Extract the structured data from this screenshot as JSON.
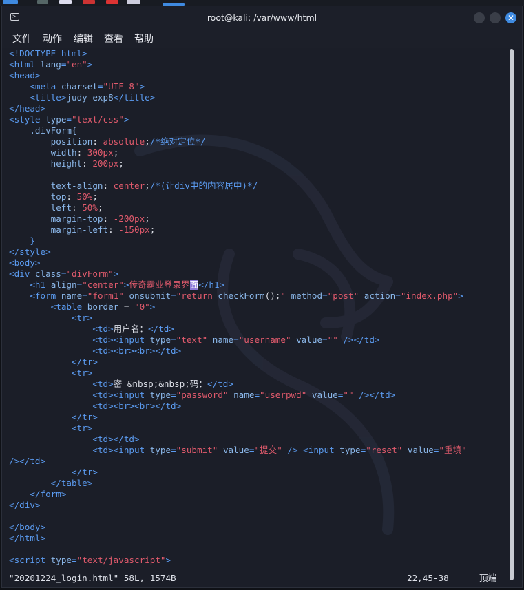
{
  "window": {
    "title": "root@kali: /var/www/html",
    "close_glyph": "✕"
  },
  "menu": [
    "文件",
    "动作",
    "编辑",
    "查看",
    "帮助"
  ],
  "code_lines": [
    [
      [
        "t",
        "<!DOCTYPE html>"
      ]
    ],
    [
      [
        "t",
        "<html "
      ],
      [
        "a",
        "lang"
      ],
      [
        "t",
        "="
      ],
      [
        "s",
        "\"en\""
      ],
      [
        "t",
        ">"
      ]
    ],
    [
      [
        "t",
        "<head>"
      ]
    ],
    [
      [
        "p",
        "    "
      ],
      [
        "t",
        "<meta "
      ],
      [
        "a",
        "charset"
      ],
      [
        "t",
        "="
      ],
      [
        "s",
        "\"UTF-8\""
      ],
      [
        "t",
        ">"
      ]
    ],
    [
      [
        "p",
        "    "
      ],
      [
        "t",
        "<title>"
      ],
      [
        "a",
        "judy-exp8"
      ],
      [
        "t",
        "</title>"
      ]
    ],
    [
      [
        "t",
        "</head>"
      ]
    ],
    [
      [
        "t",
        "<style "
      ],
      [
        "a",
        "type"
      ],
      [
        "t",
        "="
      ],
      [
        "s",
        "\"text/css\""
      ],
      [
        "t",
        ">"
      ]
    ],
    [
      [
        "p",
        "    "
      ],
      [
        "a",
        ".divForm{"
      ]
    ],
    [
      [
        "p",
        "        "
      ],
      [
        "a",
        "position"
      ],
      [
        "p",
        ": "
      ],
      [
        "s",
        "absolute"
      ],
      [
        "p",
        ";"
      ],
      [
        "c",
        "/*绝对定位*/"
      ]
    ],
    [
      [
        "p",
        "        "
      ],
      [
        "a",
        "width"
      ],
      [
        "p",
        ": "
      ],
      [
        "s",
        "300px"
      ],
      [
        "p",
        ";"
      ]
    ],
    [
      [
        "p",
        "        "
      ],
      [
        "a",
        "height"
      ],
      [
        "p",
        ": "
      ],
      [
        "s",
        "200px"
      ],
      [
        "p",
        ";"
      ]
    ],
    [
      [
        "p",
        ""
      ]
    ],
    [
      [
        "p",
        "        "
      ],
      [
        "a",
        "text-align"
      ],
      [
        "p",
        ": "
      ],
      [
        "s",
        "center"
      ],
      [
        "p",
        ";"
      ],
      [
        "c",
        "/*(让div中的内容居中)*/"
      ]
    ],
    [
      [
        "p",
        "        "
      ],
      [
        "a",
        "top"
      ],
      [
        "p",
        ": "
      ],
      [
        "s",
        "50%"
      ],
      [
        "p",
        ";"
      ]
    ],
    [
      [
        "p",
        "        "
      ],
      [
        "a",
        "left"
      ],
      [
        "p",
        ": "
      ],
      [
        "s",
        "50%"
      ],
      [
        "p",
        ";"
      ]
    ],
    [
      [
        "p",
        "        "
      ],
      [
        "a",
        "margin-top"
      ],
      [
        "p",
        ": "
      ],
      [
        "s",
        "-200px"
      ],
      [
        "p",
        ";"
      ]
    ],
    [
      [
        "p",
        "        "
      ],
      [
        "a",
        "margin-left"
      ],
      [
        "p",
        ": "
      ],
      [
        "s",
        "-150px"
      ],
      [
        "p",
        ";"
      ]
    ],
    [
      [
        "p",
        "    "
      ],
      [
        "t",
        "}"
      ]
    ],
    [
      [
        "t",
        "</style>"
      ]
    ],
    [
      [
        "t",
        "<body>"
      ]
    ],
    [
      [
        "t",
        "<div "
      ],
      [
        "a",
        "class"
      ],
      [
        "t",
        "="
      ],
      [
        "s",
        "\"divForm\""
      ],
      [
        "t",
        ">"
      ]
    ],
    [
      [
        "p",
        "    "
      ],
      [
        "t",
        "<h1 "
      ],
      [
        "a",
        "align"
      ],
      [
        "t",
        "="
      ],
      [
        "s",
        "\"center\""
      ],
      [
        "t",
        ">"
      ],
      [
        "s",
        "传奇霸业登录界"
      ],
      [
        "cursor",
        "面"
      ],
      [
        "t",
        "</h1>"
      ]
    ],
    [
      [
        "p",
        "    "
      ],
      [
        "t",
        "<form "
      ],
      [
        "a",
        "name"
      ],
      [
        "t",
        "="
      ],
      [
        "s",
        "\"form1\""
      ],
      [
        "p",
        " "
      ],
      [
        "a",
        "onsubmit"
      ],
      [
        "t",
        "="
      ],
      [
        "s",
        "\"return "
      ],
      [
        "a",
        "checkForm"
      ],
      [
        "p",
        "();"
      ],
      [
        "s",
        "\""
      ],
      [
        "p",
        " "
      ],
      [
        "a",
        "method"
      ],
      [
        "t",
        "="
      ],
      [
        "s",
        "\"post\""
      ],
      [
        "p",
        " "
      ],
      [
        "a",
        "action"
      ],
      [
        "t",
        "="
      ],
      [
        "s",
        "\"index.php\""
      ],
      [
        "t",
        ">"
      ]
    ],
    [
      [
        "p",
        "        "
      ],
      [
        "t",
        "<table "
      ],
      [
        "a",
        "border"
      ],
      [
        "p",
        " = "
      ],
      [
        "s",
        "\"0\""
      ],
      [
        "t",
        ">"
      ]
    ],
    [
      [
        "p",
        "            "
      ],
      [
        "t",
        "<tr>"
      ]
    ],
    [
      [
        "p",
        "                "
      ],
      [
        "t",
        "<td>"
      ],
      [
        "p",
        "用户名："
      ],
      [
        "t",
        "</td>"
      ]
    ],
    [
      [
        "p",
        "                "
      ],
      [
        "t",
        "<td><input "
      ],
      [
        "a",
        "type"
      ],
      [
        "t",
        "="
      ],
      [
        "s",
        "\"text\""
      ],
      [
        "p",
        " "
      ],
      [
        "a",
        "name"
      ],
      [
        "t",
        "="
      ],
      [
        "s",
        "\"username\""
      ],
      [
        "p",
        " "
      ],
      [
        "a",
        "value"
      ],
      [
        "t",
        "="
      ],
      [
        "s",
        "\"\""
      ],
      [
        "p",
        " "
      ],
      [
        "t",
        "/></td>"
      ]
    ],
    [
      [
        "p",
        "                "
      ],
      [
        "t",
        "<td><br><br></td>"
      ]
    ],
    [
      [
        "p",
        "            "
      ],
      [
        "t",
        "</tr>"
      ]
    ],
    [
      [
        "p",
        "            "
      ],
      [
        "t",
        "<tr>"
      ]
    ],
    [
      [
        "p",
        "                "
      ],
      [
        "t",
        "<td>"
      ],
      [
        "p",
        "密 &nbsp;&nbsp;码："
      ],
      [
        "t",
        "</td>"
      ]
    ],
    [
      [
        "p",
        "                "
      ],
      [
        "t",
        "<td><input "
      ],
      [
        "a",
        "type"
      ],
      [
        "t",
        "="
      ],
      [
        "s",
        "\"password\""
      ],
      [
        "p",
        " "
      ],
      [
        "a",
        "name"
      ],
      [
        "t",
        "="
      ],
      [
        "s",
        "\"userpwd\""
      ],
      [
        "p",
        " "
      ],
      [
        "a",
        "value"
      ],
      [
        "t",
        "="
      ],
      [
        "s",
        "\"\""
      ],
      [
        "p",
        " "
      ],
      [
        "t",
        "/></td>"
      ]
    ],
    [
      [
        "p",
        "                "
      ],
      [
        "t",
        "<td><br><br></td>"
      ]
    ],
    [
      [
        "p",
        "            "
      ],
      [
        "t",
        "</tr>"
      ]
    ],
    [
      [
        "p",
        "            "
      ],
      [
        "t",
        "<tr>"
      ]
    ],
    [
      [
        "p",
        "                "
      ],
      [
        "t",
        "<td></td>"
      ]
    ],
    [
      [
        "p",
        "                "
      ],
      [
        "t",
        "<td><input "
      ],
      [
        "a",
        "type"
      ],
      [
        "t",
        "="
      ],
      [
        "s",
        "\"submit\""
      ],
      [
        "p",
        " "
      ],
      [
        "a",
        "value"
      ],
      [
        "t",
        "="
      ],
      [
        "s",
        "\"提交\""
      ],
      [
        "p",
        " "
      ],
      [
        "t",
        "/>"
      ],
      [
        "p",
        " "
      ],
      [
        "t",
        "<input "
      ],
      [
        "a",
        "type"
      ],
      [
        "t",
        "="
      ],
      [
        "s",
        "\"reset\""
      ],
      [
        "p",
        " "
      ],
      [
        "a",
        "value"
      ],
      [
        "t",
        "="
      ],
      [
        "s",
        "\"重填\""
      ]
    ],
    [
      [
        "t",
        "/></td>"
      ]
    ],
    [
      [
        "p",
        "            "
      ],
      [
        "t",
        "</tr>"
      ]
    ],
    [
      [
        "p",
        "        "
      ],
      [
        "t",
        "</table>"
      ]
    ],
    [
      [
        "p",
        "    "
      ],
      [
        "t",
        "</form>"
      ]
    ],
    [
      [
        "t",
        "</div>"
      ]
    ],
    [
      [
        "p",
        ""
      ]
    ],
    [
      [
        "t",
        "</body>"
      ]
    ],
    [
      [
        "t",
        "</html>"
      ]
    ],
    [
      [
        "p",
        ""
      ]
    ],
    [
      [
        "t",
        "<script "
      ],
      [
        "a",
        "type"
      ],
      [
        "t",
        "="
      ],
      [
        "s",
        "\"text/javascript\""
      ],
      [
        "t",
        ">"
      ]
    ]
  ],
  "status": {
    "file_info": "\"20201224_login.html\" 58L, 1574B",
    "position": "22,45-38",
    "scroll_pos": "顶端"
  },
  "colors": {
    "background": "#1b1e28",
    "tag": "#5b9bf0",
    "attribute": "#8ab6e8",
    "string": "#e05a6c",
    "cursor": "#8d7ad8",
    "close_button": "#3f8ae0"
  }
}
